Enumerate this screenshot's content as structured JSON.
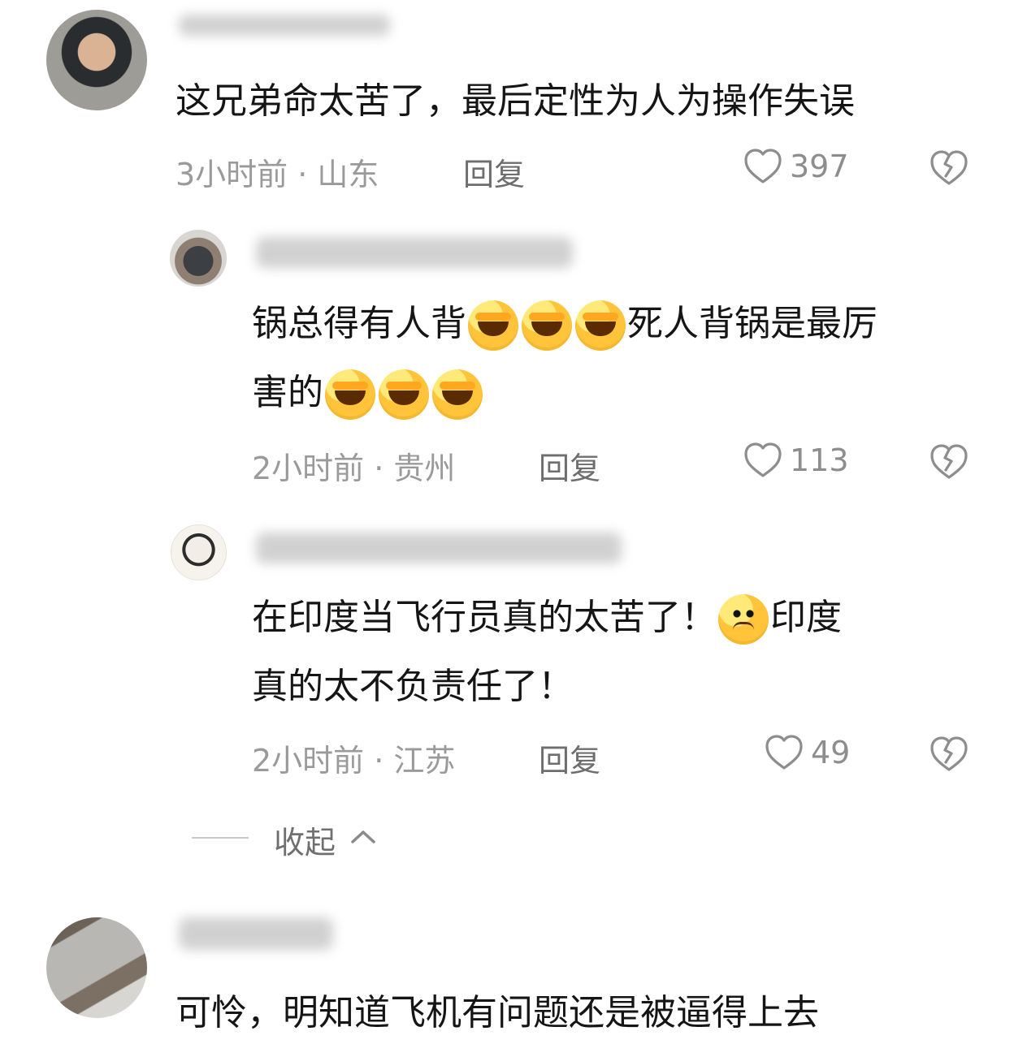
{
  "comments": [
    {
      "username": "",
      "text": "这兄弟命太苦了，最后定性为人为操作失误",
      "meta": "3小时前 · 山东",
      "reply": "回复",
      "likes": "397"
    },
    {
      "username": "",
      "text_line1_a": "锅总得有人背",
      "text_line1_b": "死人背锅是最厉",
      "text_line2_a": "害的",
      "meta": "2小时前 · 贵州",
      "reply": "回复",
      "likes": "113"
    },
    {
      "username": "",
      "text_line1_a": "在印度当飞行员真的太苦了！",
      "text_line1_b": "印度",
      "text_line2": "真的太不负责任了！",
      "meta": "2小时前 · 江苏",
      "reply": "回复",
      "likes": "49"
    },
    {
      "username": "",
      "text": "可怜，明知道飞机有问题还是被逼得上去"
    }
  ],
  "collapse": {
    "label": "收起"
  },
  "colors": {
    "meta": "#9a9a9a",
    "text": "#151515",
    "icon": "#8d8d8d"
  }
}
